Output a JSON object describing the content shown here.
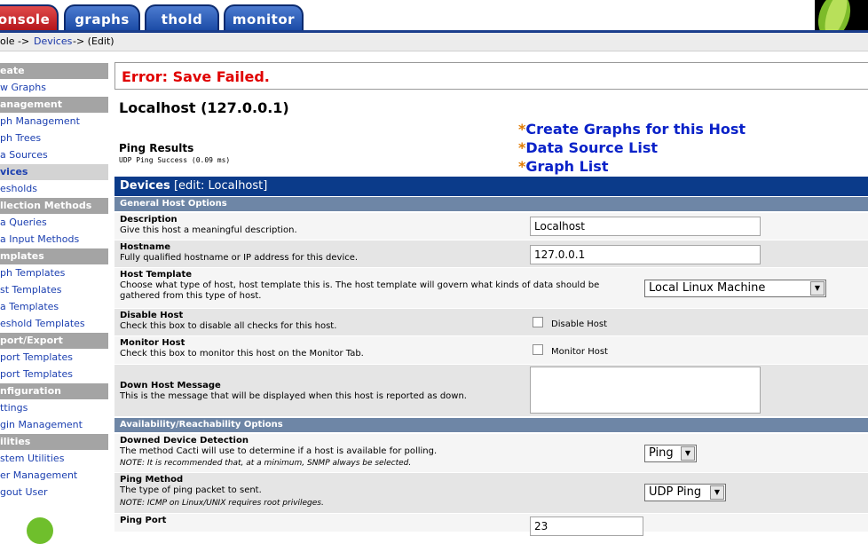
{
  "tabs": [
    {
      "label": "onsole"
    },
    {
      "label": "graphs"
    },
    {
      "label": "thold"
    },
    {
      "label": "monitor"
    }
  ],
  "breadcrumb": {
    "part1": "ole ->",
    "part2": "Devices",
    "part3": "-> (Edit)"
  },
  "menu": {
    "items": [
      {
        "label": "eate",
        "type": "header"
      },
      {
        "label": "w Graphs",
        "type": "link"
      },
      {
        "label": "anagement",
        "type": "header"
      },
      {
        "label": "ph Management",
        "type": "link"
      },
      {
        "label": "ph Trees",
        "type": "link"
      },
      {
        "label": "a Sources",
        "type": "link"
      },
      {
        "label": "vices",
        "type": "selected"
      },
      {
        "label": "esholds",
        "type": "link"
      },
      {
        "label": "llection Methods",
        "type": "header"
      },
      {
        "label": "a Queries",
        "type": "link"
      },
      {
        "label": "a Input Methods",
        "type": "link"
      },
      {
        "label": "mplates",
        "type": "header"
      },
      {
        "label": "ph Templates",
        "type": "link"
      },
      {
        "label": "st Templates",
        "type": "link"
      },
      {
        "label": "a Templates",
        "type": "link"
      },
      {
        "label": "eshold Templates",
        "type": "link"
      },
      {
        "label": "port/Export",
        "type": "header"
      },
      {
        "label": "port Templates",
        "type": "link"
      },
      {
        "label": "port Templates",
        "type": "link"
      },
      {
        "label": "nfiguration",
        "type": "header"
      },
      {
        "label": "ttings",
        "type": "link"
      },
      {
        "label": "gin Management",
        "type": "link"
      },
      {
        "label": "ilities",
        "type": "header"
      },
      {
        "label": "stem Utilities",
        "type": "link"
      },
      {
        "label": "er Management",
        "type": "link"
      },
      {
        "label": "gout User",
        "type": "link"
      }
    ]
  },
  "error": {
    "message": "Error: Save Failed."
  },
  "host": {
    "title": "Localhost (127.0.0.1)",
    "ping_title": "Ping Results",
    "ping_result": "UDP Ping Success (0.09 ms)"
  },
  "links": {
    "star": "*",
    "create_graphs": "Create Graphs for this Host",
    "data_source_list": "Data Source List",
    "graph_list": "Graph List"
  },
  "devices_header": {
    "title": "Devices",
    "subtitle": "[edit: Localhost]"
  },
  "sections": {
    "general": "General Host Options",
    "availability": "Availability/Reachability Options"
  },
  "fields": {
    "description": {
      "label": "Description",
      "desc": "Give this host a meaningful description.",
      "value": "Localhost"
    },
    "hostname": {
      "label": "Hostname",
      "desc": "Fully qualified hostname or IP address for this device.",
      "value": "127.0.0.1"
    },
    "host_template": {
      "label": "Host Template",
      "desc": "Choose what type of host, host template this is. The host template will govern what kinds of data should be gathered from this type of host.",
      "value": "Local Linux Machine"
    },
    "disable_host": {
      "label": "Disable Host",
      "desc": "Check this box to disable all checks for this host.",
      "checkbox_label": "Disable Host"
    },
    "monitor_host": {
      "label": "Monitor Host",
      "desc": "Check this box to monitor this host on the Monitor Tab.",
      "checkbox_label": "Monitor Host"
    },
    "down_message": {
      "label": "Down Host Message",
      "desc": "This is the message that will be displayed when this host is reported as down.",
      "value": ""
    },
    "downed_detection": {
      "label": "Downed Device Detection",
      "desc": "The method Cacti will use to determine if a host is available for polling.",
      "note": "NOTE: It is recommended that, at a minimum, SNMP always be selected.",
      "value": "Ping"
    },
    "ping_method": {
      "label": "Ping Method",
      "desc": "The type of ping packet to sent.",
      "note": "NOTE: ICMP on Linux/UNIX requires root privileges.",
      "value": "UDP Ping"
    },
    "ping_port": {
      "label": "Ping Port",
      "value": "23"
    }
  }
}
